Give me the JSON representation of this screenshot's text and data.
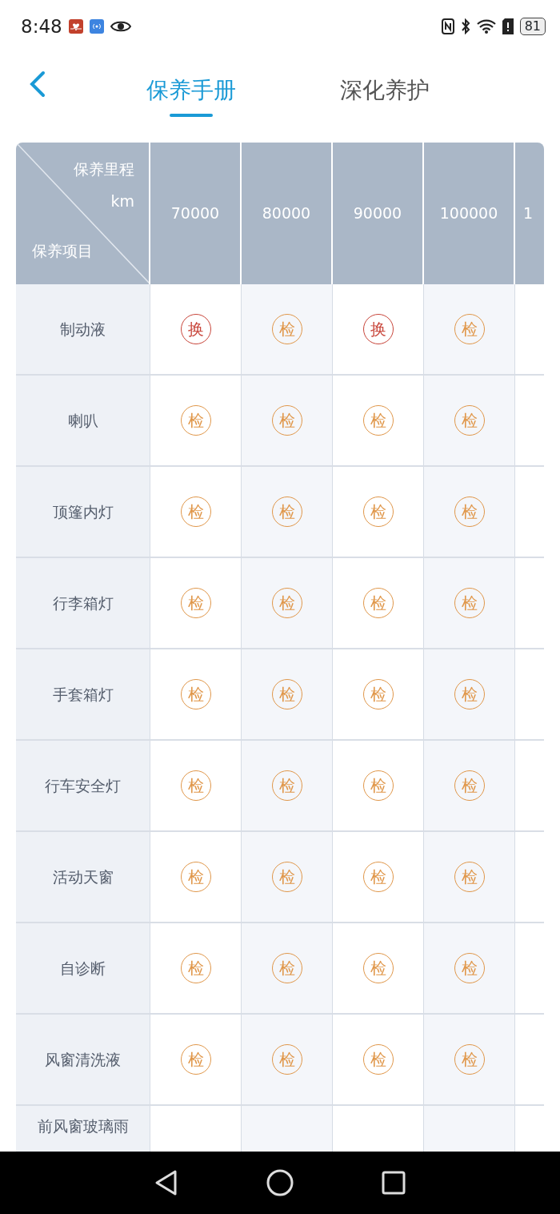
{
  "status_bar": {
    "time": "8:48",
    "battery": "81"
  },
  "tabs": [
    {
      "label": "保养手册",
      "selected": true
    },
    {
      "label": "深化养护",
      "selected": false
    }
  ],
  "table": {
    "corner": {
      "top": "保养里程",
      "unit": "km",
      "bottom": "保养项目"
    },
    "columns": [
      "70000",
      "80000",
      "90000",
      "100000",
      "1"
    ],
    "rows": [
      {
        "item": "制动液",
        "cells": [
          {
            "kind": "replace",
            "mark": "换"
          },
          {
            "kind": "check",
            "mark": "检"
          },
          {
            "kind": "replace",
            "mark": "换"
          },
          {
            "kind": "check",
            "mark": "检"
          }
        ]
      },
      {
        "item": "喇叭",
        "cells": [
          {
            "kind": "check",
            "mark": "检"
          },
          {
            "kind": "check",
            "mark": "检"
          },
          {
            "kind": "check",
            "mark": "检"
          },
          {
            "kind": "check",
            "mark": "检"
          }
        ]
      },
      {
        "item": "顶篷内灯",
        "cells": [
          {
            "kind": "check",
            "mark": "检"
          },
          {
            "kind": "check",
            "mark": "检"
          },
          {
            "kind": "check",
            "mark": "检"
          },
          {
            "kind": "check",
            "mark": "检"
          }
        ]
      },
      {
        "item": "行李箱灯",
        "cells": [
          {
            "kind": "check",
            "mark": "检"
          },
          {
            "kind": "check",
            "mark": "检"
          },
          {
            "kind": "check",
            "mark": "检"
          },
          {
            "kind": "check",
            "mark": "检"
          }
        ]
      },
      {
        "item": "手套箱灯",
        "cells": [
          {
            "kind": "check",
            "mark": "检"
          },
          {
            "kind": "check",
            "mark": "检"
          },
          {
            "kind": "check",
            "mark": "检"
          },
          {
            "kind": "check",
            "mark": "检"
          }
        ]
      },
      {
        "item": "行车安全灯",
        "cells": [
          {
            "kind": "check",
            "mark": "检"
          },
          {
            "kind": "check",
            "mark": "检"
          },
          {
            "kind": "check",
            "mark": "检"
          },
          {
            "kind": "check",
            "mark": "检"
          }
        ]
      },
      {
        "item": "活动天窗",
        "cells": [
          {
            "kind": "check",
            "mark": "检"
          },
          {
            "kind": "check",
            "mark": "检"
          },
          {
            "kind": "check",
            "mark": "检"
          },
          {
            "kind": "check",
            "mark": "检"
          }
        ]
      },
      {
        "item": "自诊断",
        "cells": [
          {
            "kind": "check",
            "mark": "检"
          },
          {
            "kind": "check",
            "mark": "检"
          },
          {
            "kind": "check",
            "mark": "检"
          },
          {
            "kind": "check",
            "mark": "检"
          }
        ]
      },
      {
        "item": "风窗清洗液",
        "cells": [
          {
            "kind": "check",
            "mark": "检"
          },
          {
            "kind": "check",
            "mark": "检"
          },
          {
            "kind": "check",
            "mark": "检"
          },
          {
            "kind": "check",
            "mark": "检"
          }
        ]
      },
      {
        "item": "前风窗玻璃雨",
        "cells": []
      }
    ]
  }
}
